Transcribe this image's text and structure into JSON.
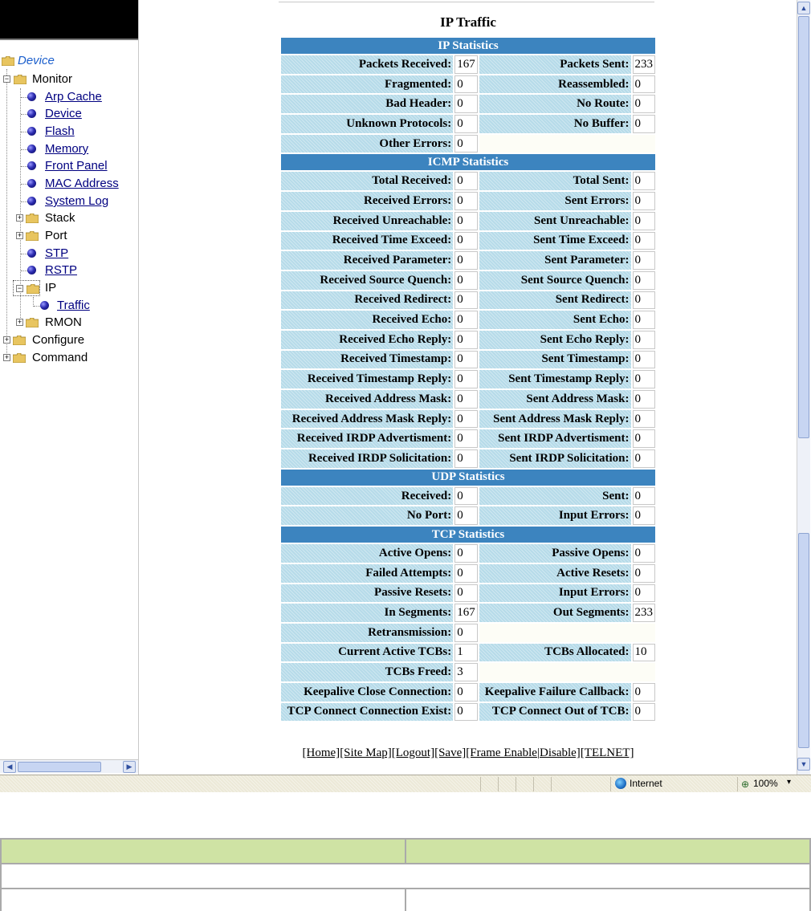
{
  "nav": {
    "root": "Device",
    "monitor": "Monitor",
    "arp_cache": "Arp Cache",
    "device": "Device",
    "flash": "Flash",
    "memory": "Memory",
    "front_panel": "Front Panel",
    "mac_address": "MAC Address",
    "system_log": "System Log",
    "stack": "Stack",
    "port": "Port",
    "stp": "STP",
    "rstp": "RSTP",
    "ip": "IP",
    "traffic": "Traffic",
    "rmon": "RMON",
    "configure": "Configure",
    "command": "Command"
  },
  "page": {
    "title": "IP Traffic"
  },
  "sections": {
    "ip": {
      "header": "IP Statistics",
      "rows": [
        {
          "l1": "Packets Received:",
          "v1": "167",
          "l2": "Packets Sent:",
          "v2": "233"
        },
        {
          "l1": "Fragmented:",
          "v1": "0",
          "l2": "Reassembled:",
          "v2": "0"
        },
        {
          "l1": "Bad Header:",
          "v1": "0",
          "l2": "No Route:",
          "v2": "0"
        },
        {
          "l1": "Unknown Protocols:",
          "v1": "0",
          "l2": "No Buffer:",
          "v2": "0"
        },
        {
          "l1": "Other Errors:",
          "v1": "0",
          "l2": "",
          "v2": ""
        }
      ]
    },
    "icmp": {
      "header": "ICMP Statistics",
      "rows": [
        {
          "l1": "Total Received:",
          "v1": "0",
          "l2": "Total Sent:",
          "v2": "0"
        },
        {
          "l1": "Received Errors:",
          "v1": "0",
          "l2": "Sent Errors:",
          "v2": "0"
        },
        {
          "l1": "Received Unreachable:",
          "v1": "0",
          "l2": "Sent Unreachable:",
          "v2": "0"
        },
        {
          "l1": "Received Time Exceed:",
          "v1": "0",
          "l2": "Sent Time Exceed:",
          "v2": "0"
        },
        {
          "l1": "Received Parameter:",
          "v1": "0",
          "l2": "Sent Parameter:",
          "v2": "0"
        },
        {
          "l1": "Received Source Quench:",
          "v1": "0",
          "l2": "Sent Source Quench:",
          "v2": "0"
        },
        {
          "l1": "Received Redirect:",
          "v1": "0",
          "l2": "Sent Redirect:",
          "v2": "0"
        },
        {
          "l1": "Received Echo:",
          "v1": "0",
          "l2": "Sent Echo:",
          "v2": "0"
        },
        {
          "l1": "Received Echo Reply:",
          "v1": "0",
          "l2": "Sent Echo Reply:",
          "v2": "0"
        },
        {
          "l1": "Received Timestamp:",
          "v1": "0",
          "l2": "Sent Timestamp:",
          "v2": "0"
        },
        {
          "l1": "Received Timestamp Reply:",
          "v1": "0",
          "l2": "Sent Timestamp Reply:",
          "v2": "0"
        },
        {
          "l1": "Received Address Mask:",
          "v1": "0",
          "l2": "Sent Address Mask:",
          "v2": "0"
        },
        {
          "l1": "Received Address Mask Reply:",
          "v1": "0",
          "l2": "Sent Address Mask Reply:",
          "v2": "0"
        },
        {
          "l1": "Received IRDP Advertisment:",
          "v1": "0",
          "l2": "Sent IRDP Advertisment:",
          "v2": "0"
        },
        {
          "l1": "Received IRDP Solicitation:",
          "v1": "0",
          "l2": "Sent IRDP Solicitation:",
          "v2": "0"
        }
      ]
    },
    "udp": {
      "header": "UDP Statistics",
      "rows": [
        {
          "l1": "Received:",
          "v1": "0",
          "l2": "Sent:",
          "v2": "0"
        },
        {
          "l1": "No Port:",
          "v1": "0",
          "l2": "Input Errors:",
          "v2": "0"
        }
      ]
    },
    "tcp": {
      "header": "TCP Statistics",
      "rows": [
        {
          "l1": "Active Opens:",
          "v1": "0",
          "l2": "Passive Opens:",
          "v2": "0"
        },
        {
          "l1": "Failed Attempts:",
          "v1": "0",
          "l2": "Active Resets:",
          "v2": "0"
        },
        {
          "l1": "Passive Resets:",
          "v1": "0",
          "l2": "Input Errors:",
          "v2": "0"
        },
        {
          "l1": "In Segments:",
          "v1": "167",
          "l2": "Out Segments:",
          "v2": "233"
        },
        {
          "l1": "Retransmission:",
          "v1": "0",
          "l2": "",
          "v2": ""
        },
        {
          "l1": "Current Active TCBs:",
          "v1": "1",
          "l2": "TCBs Allocated:",
          "v2": "10"
        },
        {
          "l1": "TCBs Freed:",
          "v1": "3",
          "l2": "",
          "v2": ""
        },
        {
          "l1": "Keepalive Close Connection:",
          "v1": "0",
          "l2": "Keepalive Failure Callback:",
          "v2": "0"
        },
        {
          "l1": "TCP Connect Connection Exist:",
          "v1": "0",
          "l2": "TCP Connect Out of TCB:",
          "v2": "0"
        }
      ]
    }
  },
  "footer": {
    "home": "[Home]",
    "site_map": "[Site Map]",
    "logout": "[Logout]",
    "save": "[Save]",
    "frame_enable": "[Frame Enable",
    "sep": "|",
    "disable": "Disable]",
    "telnet": "[TELNET]"
  },
  "statusbar": {
    "zone": "Internet",
    "zoom": "100%"
  },
  "icons": {
    "folder": "folder-icon",
    "bullet": "bullet-icon",
    "expand": "plus-icon",
    "collapse": "minus-icon",
    "globe": "globe-icon",
    "zoom": "zoom-icon"
  },
  "colors": {
    "section_header": "#3c84bf",
    "label_cell": "#b6dbe9",
    "link": "#000080",
    "doc_table_header": "#cfe3a4"
  }
}
